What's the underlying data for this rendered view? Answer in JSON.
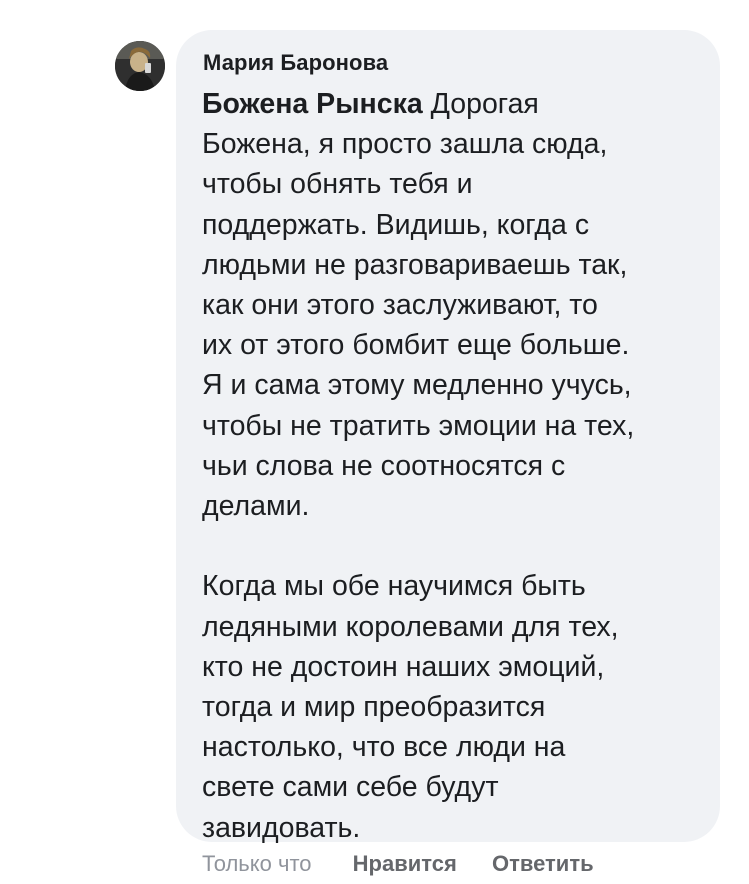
{
  "comment": {
    "author": "Мария Баронова",
    "mention": "Божена Рынска",
    "first_line_rest": " Дорогая",
    "paragraph1_lines": [
      "Божена, я просто зашла сюда,",
      "чтобы обнять тебя и",
      "поддержать. Видишь, когда с",
      "людьми не разговариваешь так,",
      "как они этого заслуживают, то",
      "их от этого бомбит еще больше.",
      "Я и сама этому медленно учусь,",
      "чтобы не тратить эмоции на тех,",
      "чьи слова не соотносятся с",
      "делами."
    ],
    "paragraph2_lines": [
      "Когда мы обе научимся быть",
      "ледяными королевами для тех,",
      "кто не достоин наших эмоций,",
      "тогда и мир преобразится",
      "настолько, что все люди на",
      "свете сами себе будут",
      "завидовать."
    ]
  },
  "actions": {
    "timestamp": "Только что",
    "like_label": "Нравится",
    "reply_label": "Ответить"
  },
  "icons": {
    "avatar": "user-avatar-photo"
  },
  "colors": {
    "bubble_background": "#f0f2f5",
    "text": "#1c1e21",
    "meta": "#65676b"
  }
}
